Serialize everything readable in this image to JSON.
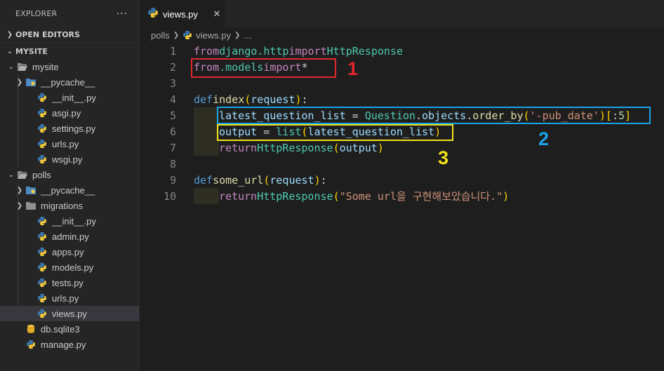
{
  "sidebar": {
    "title": "EXPLORER",
    "more": "···",
    "open_editors": "OPEN EDITORS",
    "project": "MYSITE",
    "tree": [
      {
        "label": "mysite",
        "type": "folder-open"
      },
      {
        "label": "__pycache__",
        "type": "folder-special"
      },
      {
        "label": "__init__.py",
        "type": "py"
      },
      {
        "label": "asgi.py",
        "type": "py"
      },
      {
        "label": "settings.py",
        "type": "py"
      },
      {
        "label": "urls.py",
        "type": "py"
      },
      {
        "label": "wsgi.py",
        "type": "py"
      },
      {
        "label": "polls",
        "type": "folder-open"
      },
      {
        "label": "__pycache__",
        "type": "folder-special"
      },
      {
        "label": "migrations",
        "type": "folder"
      },
      {
        "label": "__init__.py",
        "type": "py"
      },
      {
        "label": "admin.py",
        "type": "py"
      },
      {
        "label": "apps.py",
        "type": "py"
      },
      {
        "label": "models.py",
        "type": "py"
      },
      {
        "label": "tests.py",
        "type": "py"
      },
      {
        "label": "urls.py",
        "type": "py"
      },
      {
        "label": "views.py",
        "type": "py"
      },
      {
        "label": "db.sqlite3",
        "type": "db"
      },
      {
        "label": "manage.py",
        "type": "py"
      }
    ]
  },
  "tab": {
    "label": "views.py",
    "close": "✕"
  },
  "breadcrumb": {
    "folder": "polls",
    "file": "views.py",
    "rest": "..."
  },
  "code": {
    "line_numbers": [
      "1",
      "2",
      "3",
      "4",
      "5",
      "6",
      "7",
      "8",
      "9",
      "10"
    ],
    "l1": {
      "from": "from",
      "module": "django.http",
      "import": "import",
      "name": "HttpResponse"
    },
    "l2": {
      "from": "from",
      "module": ".models",
      "import": "import",
      "star": "*"
    },
    "l4": {
      "def": "def",
      "name": "index",
      "open": "(",
      "param": "request",
      "close": ")",
      "colon": ":"
    },
    "l5": {
      "var": "latest_question_list",
      "eq": " = ",
      "cls": "Question",
      "dot1": ".",
      "objects": "objects",
      "dot2": ".",
      "method": "order_by",
      "open": "(",
      "arg": "'-pub_date'",
      "close": ")",
      "slice_open": "[",
      "colon": ":",
      "num": "5",
      "slice_close": "]"
    },
    "l6": {
      "var": "output",
      "eq": " = ",
      "fn": "list",
      "open": "(",
      "arg": "latest_question_list",
      "close": ")"
    },
    "l7": {
      "ret": "return",
      "fn": "HttpResponse",
      "open": "(",
      "arg": "output",
      "close": ")"
    },
    "l9": {
      "def": "def",
      "name": "some_url",
      "open": "(",
      "param": "request",
      "close": ")",
      "colon": ":"
    },
    "l10": {
      "ret": "return",
      "fn": "HttpResponse",
      "open": "(",
      "arg": "\"Some url을 구현해보았습니다.\"",
      "close": ")"
    }
  },
  "annotations": {
    "m1": "1",
    "m2": "2",
    "m3": "3",
    "red": "#e0282e",
    "blue": "#1aa3e8",
    "yellow": "#f4e21b"
  }
}
